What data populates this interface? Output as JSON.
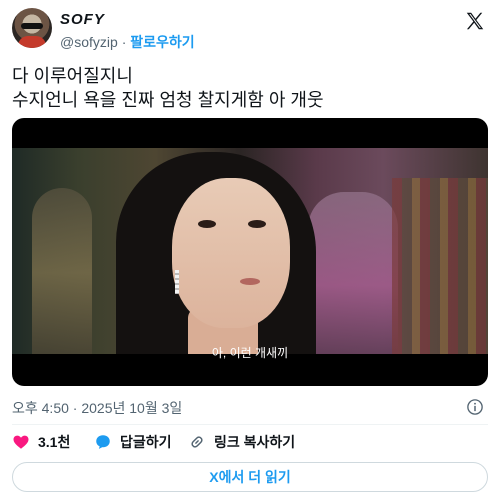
{
  "author": {
    "display_name": "SOFY",
    "handle": "@sofyzip",
    "separator": "·",
    "follow_label": "팔로우하기"
  },
  "tweet": {
    "lines": [
      "다 이루어질지니",
      "수지언니 욕을 진짜 엄청 찰지게함 아 개웃"
    ]
  },
  "media": {
    "subtitle": "아, 이런 개새끼"
  },
  "meta": {
    "timestamp": "오후 4:50 · 2025년 10월 3일"
  },
  "actions": {
    "like_count": "3.1천",
    "reply_label": "답글하기",
    "copy_link_label": "링크 복사하기"
  },
  "read_more_label": "X에서 더 읽기",
  "colors": {
    "accent": "#1d9bf0",
    "like": "#f91880",
    "text": "#0f1419",
    "muted": "#536471"
  }
}
